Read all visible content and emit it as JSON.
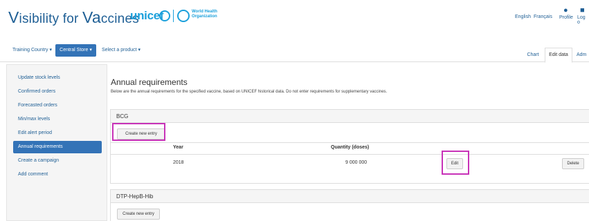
{
  "header": {
    "brand_v": "V",
    "brand_mid": "isibility for ",
    "brand_va": "Va",
    "brand_end": "ccines",
    "unicef": "unicef",
    "who_text": "World Health Organization",
    "languages": [
      "English",
      "Français"
    ],
    "profile_label": "Profile",
    "logout_label": "Log o"
  },
  "nav": {
    "country": "Training Country",
    "store": "Central Store",
    "product": "Select a product",
    "tabs": [
      "Chart",
      "Edit data",
      "Adm"
    ]
  },
  "sidebar": {
    "items": [
      "Update stock levels",
      "Confirmed orders",
      "Forecasted orders",
      "Min/max levels",
      "Edit alert period",
      "Annual requirements",
      "Create a campaign",
      "Add comment"
    ]
  },
  "main": {
    "title": "Annual requirements",
    "description": "Below are the annual requirements for the specified vaccine, based on UNICEF historical data. Do not enter requirements for supplementary vaccines.",
    "panels": [
      {
        "name": "BCG",
        "create_label": "Create new entry",
        "col_year": "Year",
        "col_quantity": "Quantity (doses)",
        "rows": [
          {
            "year": "2018",
            "quantity": "9 000 000",
            "edit_label": "Edit",
            "delete_label": "Delete"
          }
        ]
      },
      {
        "name": "DTP-HepB-Hib",
        "create_label": "Create new entry"
      }
    ]
  },
  "colors": {
    "brand_blue": "#1f5f95",
    "accent_blue": "#3373b7",
    "unicef_blue": "#1ca0db",
    "highlight": "#c832b8"
  }
}
